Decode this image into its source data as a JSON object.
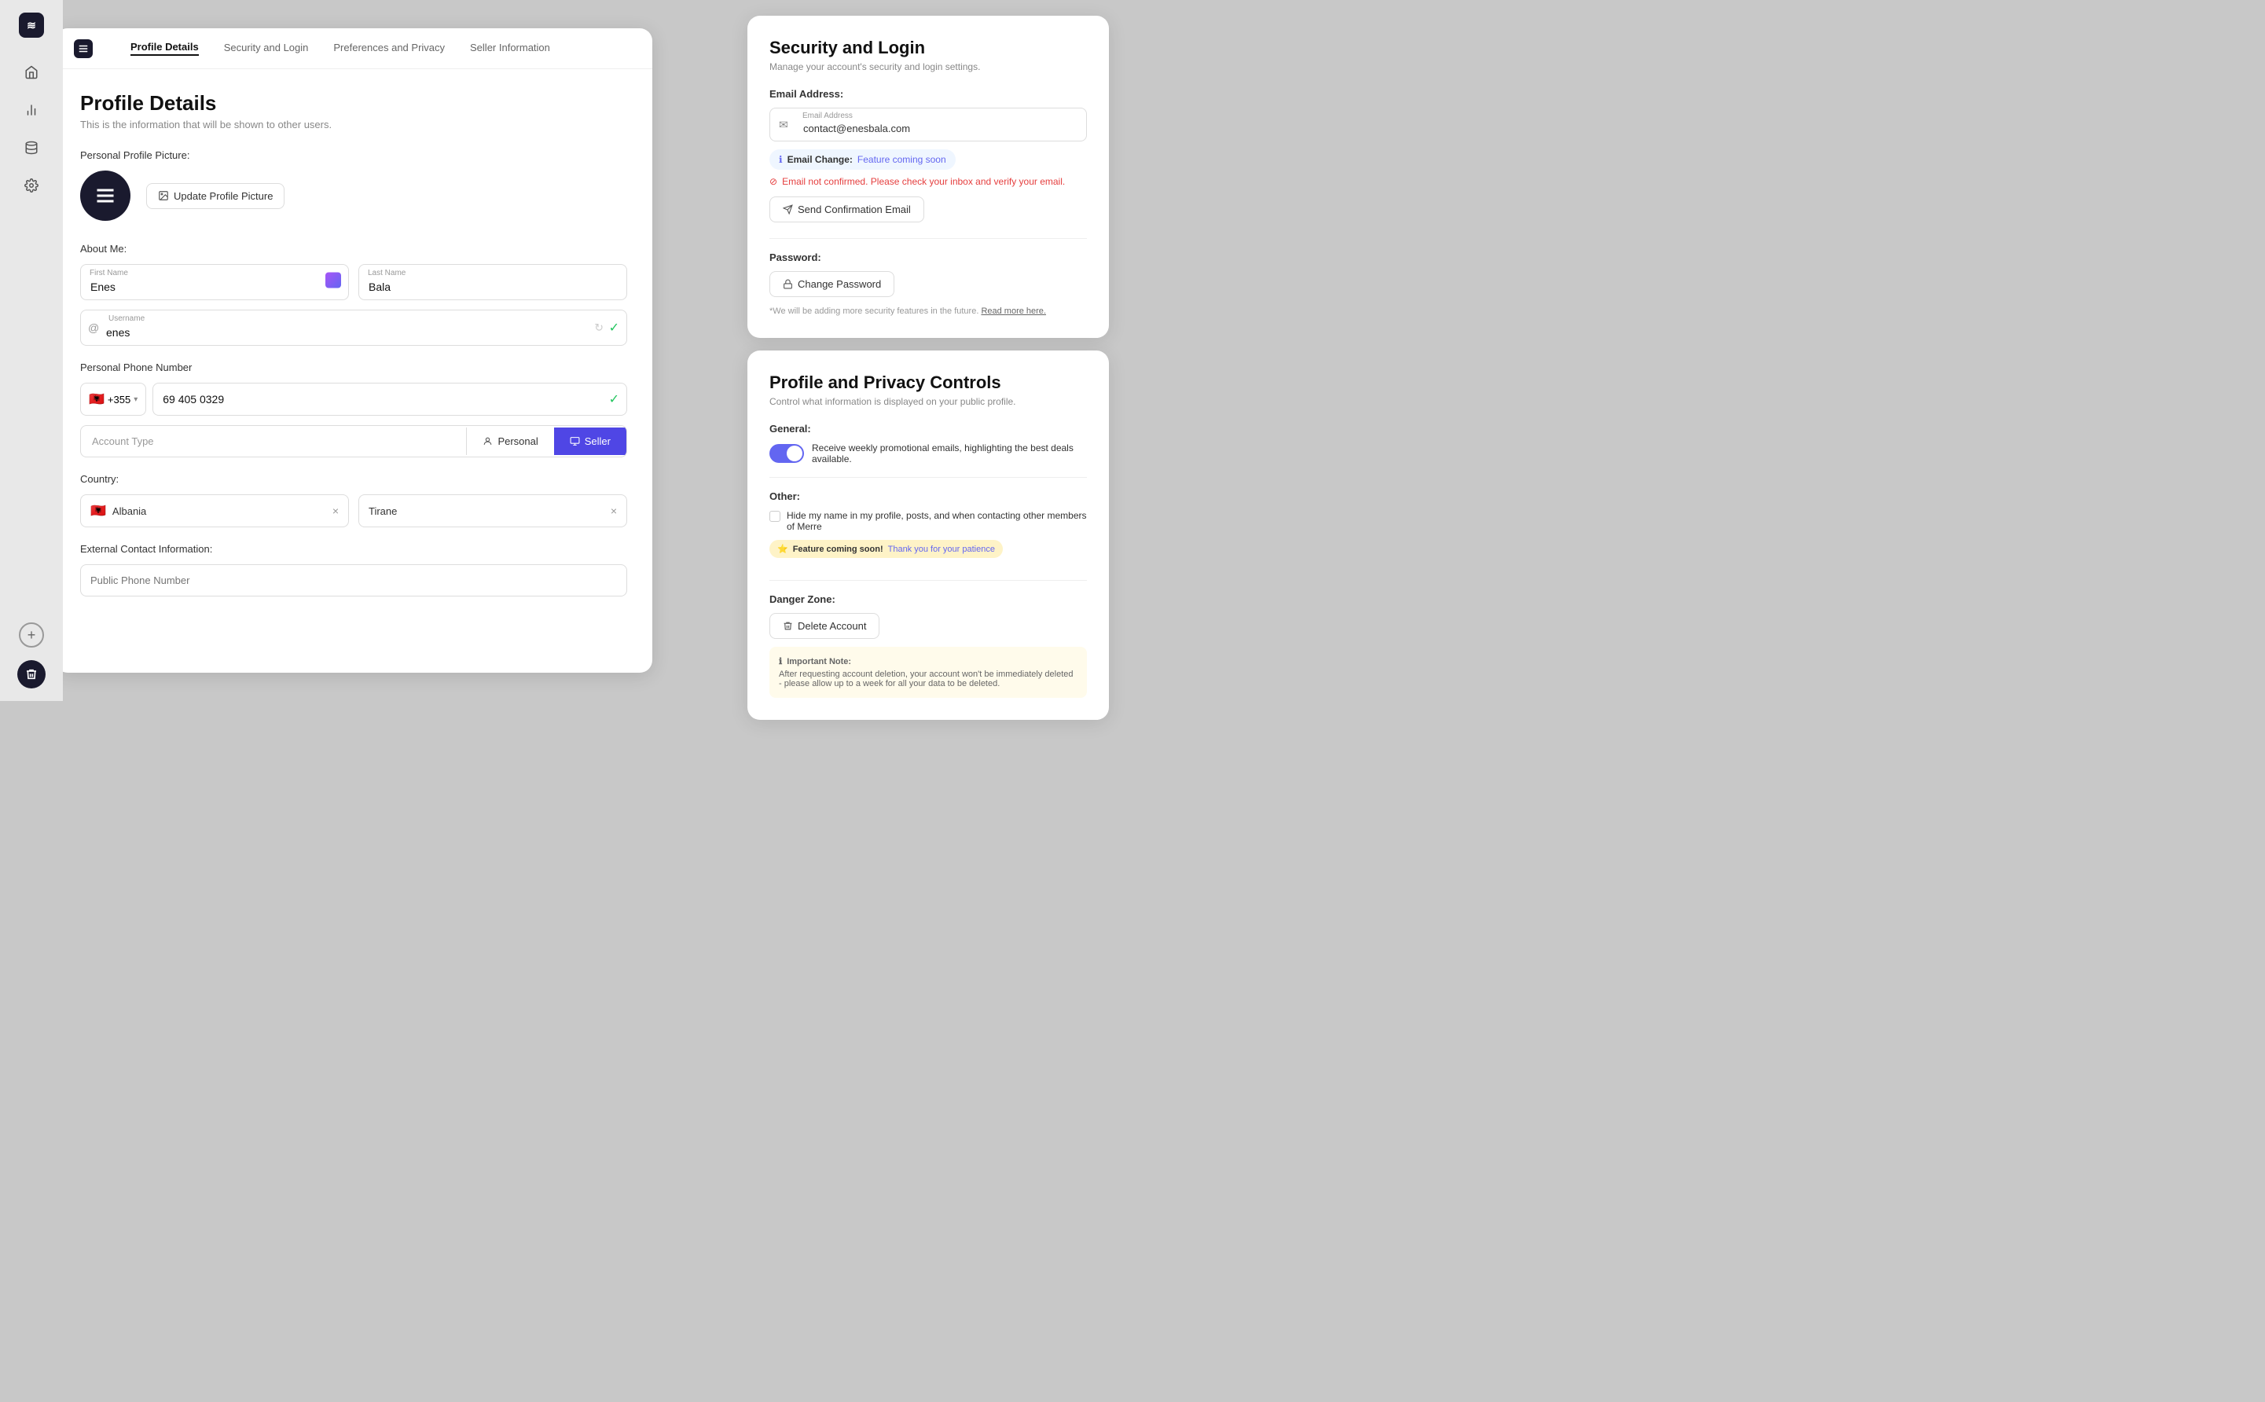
{
  "sidebar": {
    "logo_text": "≋",
    "avatar_text": "≋",
    "icons": [
      {
        "name": "home-icon",
        "glyph": "⌂"
      },
      {
        "name": "chart-icon",
        "glyph": "📊"
      },
      {
        "name": "database-icon",
        "glyph": "🗄"
      },
      {
        "name": "settings-icon",
        "glyph": "⚙"
      }
    ],
    "add_label": "+",
    "bottom_avatar": "≋"
  },
  "tabs": {
    "items": [
      {
        "label": "Profile Details",
        "active": true
      },
      {
        "label": "Security and Login",
        "active": false
      },
      {
        "label": "Preferences and Privacy",
        "active": false
      },
      {
        "label": "Seller Information",
        "active": false
      }
    ]
  },
  "profile": {
    "title": "Profile Details",
    "description": "This is the information that will be shown to other users.",
    "picture_label": "Personal Profile Picture:",
    "update_button": "Update Profile Picture",
    "about_label": "About Me:",
    "first_name_label": "First Name",
    "first_name_value": "Enes",
    "last_name_label": "Last Name",
    "last_name_value": "Bala",
    "username_label": "Username",
    "username_value": "enes",
    "phone_label": "Personal Phone Number",
    "phone_code": "+355",
    "phone_value": "69 405 0329",
    "account_type_label": "Account Type",
    "account_personal": "Personal",
    "account_seller": "Seller",
    "country_label": "Country:",
    "country_value": "Albania",
    "city_value": "Tirane",
    "external_label": "External Contact Information:",
    "public_phone_placeholder": "Public Phone Number"
  },
  "security": {
    "title": "Security and Login",
    "description": "Manage your account's security and login settings.",
    "email_section_label": "Email Address:",
    "email_field_label": "Email Address",
    "email_value": "contact@enesbala.com",
    "email_change_badge_key": "Email Change:",
    "email_change_badge_val": "Feature coming soon",
    "error_text": "Email not confirmed. Please check your inbox and verify your email.",
    "confirm_btn": "Send Confirmation Email",
    "password_label": "Password:",
    "change_password_btn": "Change Password",
    "note": "*We will be adding more security features in the future.",
    "read_more": "Read more here."
  },
  "privacy": {
    "title": "Profile and Privacy Controls",
    "description": "Control what information is displayed on your public profile.",
    "general_label": "General:",
    "toggle_label": "Receive weekly promotional emails, highlighting the best deals available.",
    "other_label": "Other:",
    "hide_checkbox_label": "Hide my name in my profile, posts, and when contacting other members of Merre",
    "coming_soon_key": "Feature coming soon!",
    "coming_soon_val": "Thank you for your patience",
    "danger_label": "Danger Zone:",
    "delete_btn": "Delete Account",
    "important_title": "Important Note:",
    "important_text": "After requesting account deletion, your account won't be immediately deleted - please allow up to a week for all your data to be deleted."
  }
}
